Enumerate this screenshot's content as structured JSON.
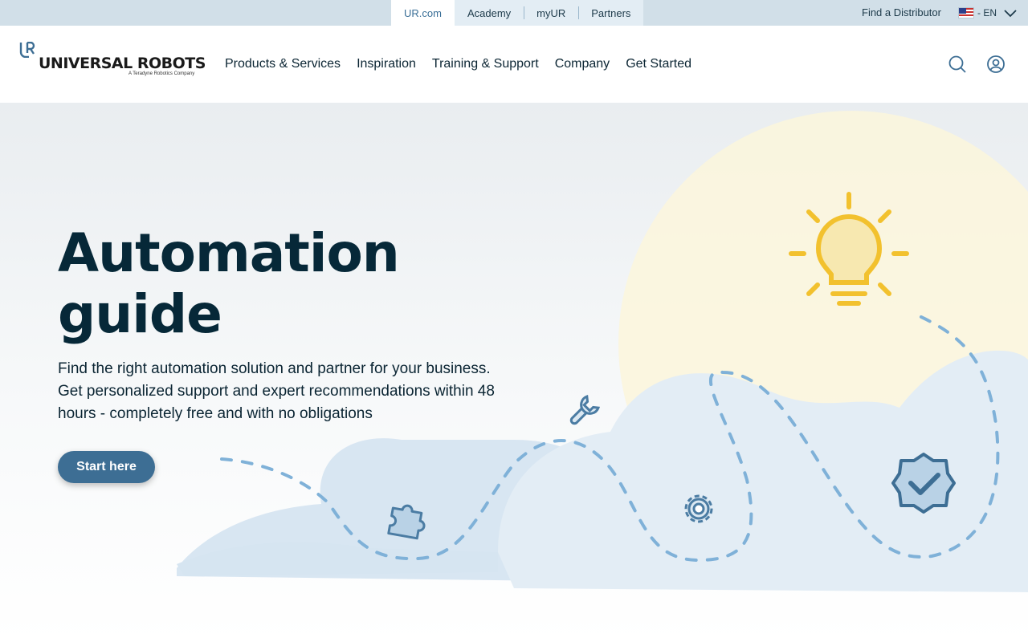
{
  "topbar": {
    "sites": [
      "UR.com",
      "Academy",
      "myUR",
      "Partners"
    ],
    "distributor": "Find a Distributor",
    "language": "- EN"
  },
  "header": {
    "logo_text": "UNIVERSAL ROBOTS",
    "logo_tagline": "A Teradyne Robotics Company",
    "nav": [
      "Products & Services",
      "Inspiration",
      "Training & Support",
      "Company",
      "Get Started"
    ],
    "icons": [
      "search-icon",
      "account-icon"
    ]
  },
  "hero": {
    "title_line1": "Automation",
    "title_line2": "guide",
    "lead": "Find the right automation solution and partner for your business. Get personalized support and expert recommendations within 48 hours - completely free and with no obligations",
    "cta": "Start here"
  },
  "colors": {
    "accent": "#3d6e94",
    "topbar_bg": "#d1dfe8",
    "heading": "#062838",
    "bulb": "#f2c12e"
  }
}
